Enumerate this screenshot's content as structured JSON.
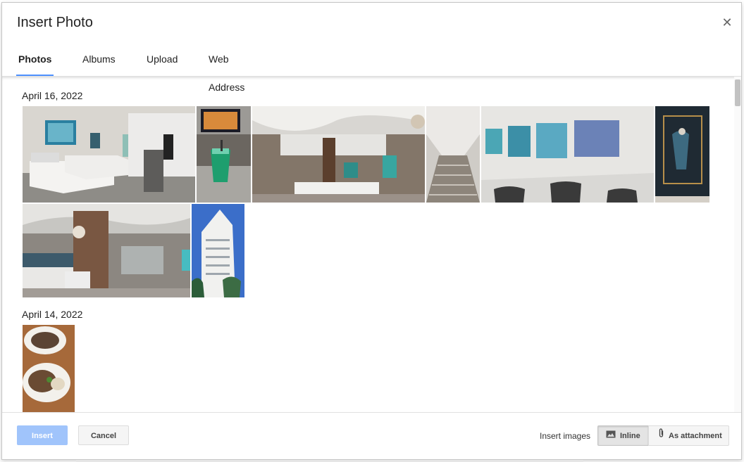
{
  "dialog": {
    "title": "Insert Photo",
    "close_icon": "close-icon"
  },
  "tabs": [
    {
      "label": "Photos",
      "active": true
    },
    {
      "label": "Albums",
      "active": false
    },
    {
      "label": "Upload",
      "active": false
    },
    {
      "label": "Web Address (URL)",
      "active": false
    }
  ],
  "groups": [
    {
      "date": "April 16, 2022",
      "photos": [
        {
          "subject": "hotel bedroom with two beds"
        },
        {
          "subject": "green cocktail in front of tv"
        },
        {
          "subject": "hotel lobby with white ceiling"
        },
        {
          "subject": "staircase"
        },
        {
          "subject": "gallery wall with underwater paintings"
        },
        {
          "subject": "framed dark painting"
        },
        {
          "subject": "lobby bar with pillar"
        },
        {
          "subject": "white hotel tower and palm trees"
        }
      ]
    },
    {
      "date": "April 14, 2022",
      "photos": [
        {
          "subject": "two plates of food on wooden table"
        }
      ]
    }
  ],
  "footer": {
    "insert_label": "Insert",
    "cancel_label": "Cancel",
    "insert_images_label": "Insert images",
    "inline_label": "Inline",
    "attachment_label": "As attachment",
    "inline_icon": "image-icon",
    "attachment_icon": "paperclip-icon"
  },
  "colors": {
    "tab_accent": "#4d90fe",
    "insert_button": "#a0c4fb"
  }
}
